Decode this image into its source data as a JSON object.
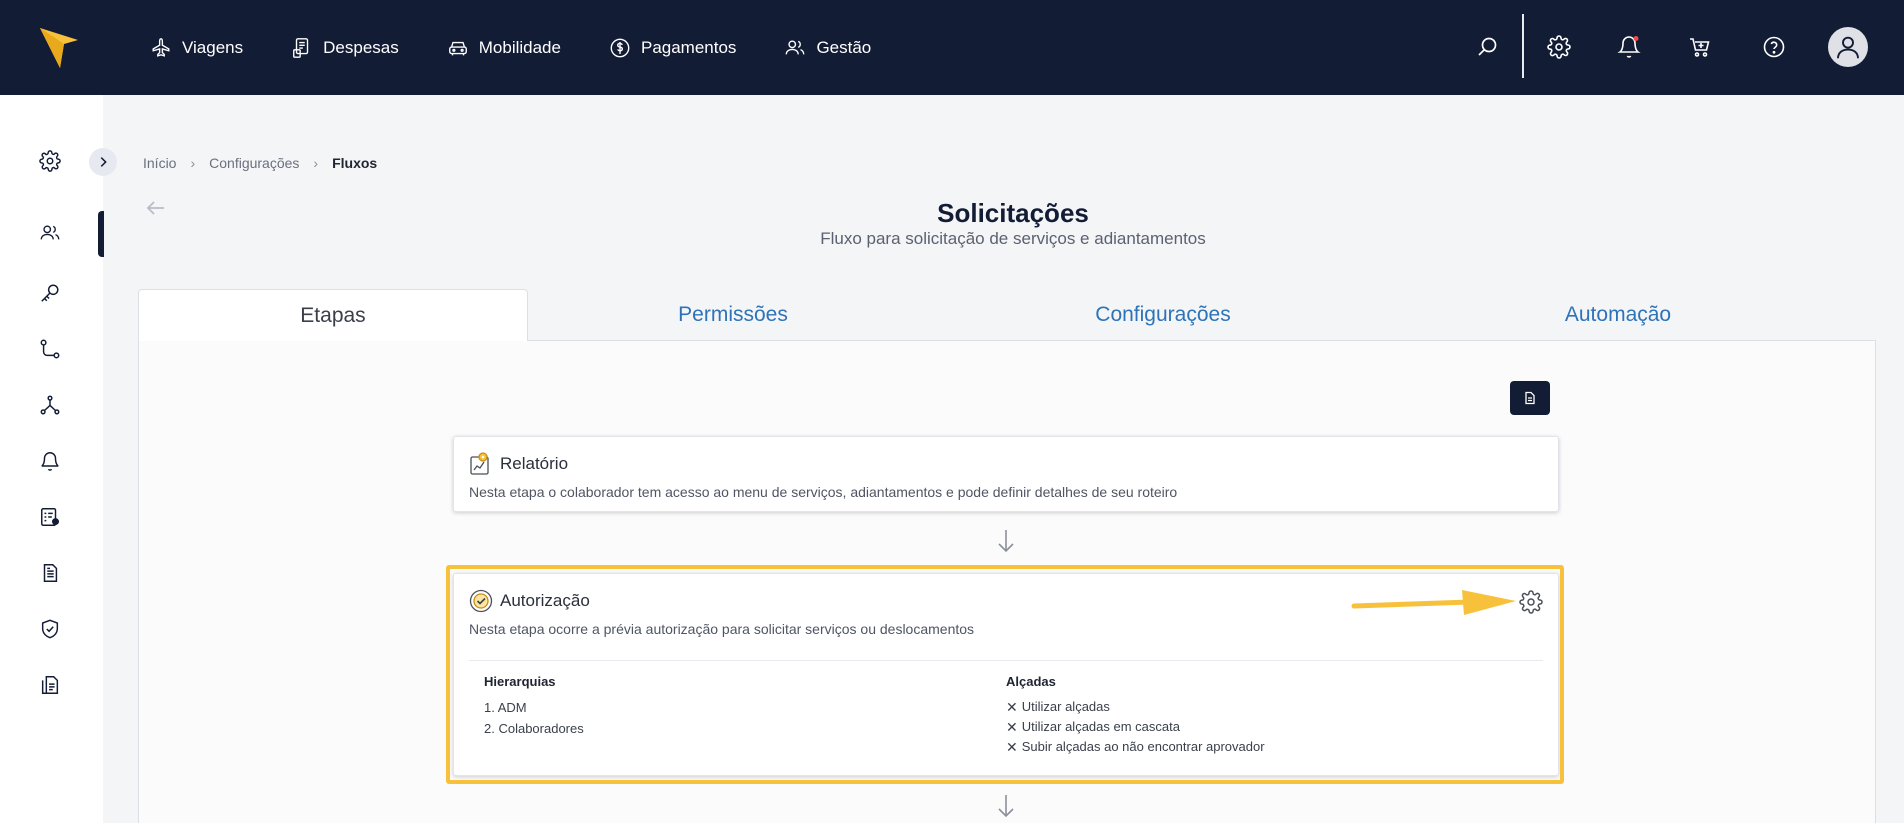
{
  "nav": {
    "items": [
      {
        "label": "Viagens",
        "icon": "plane-icon"
      },
      {
        "label": "Despesas",
        "icon": "receipt-icon"
      },
      {
        "label": "Mobilidade",
        "icon": "car-icon"
      },
      {
        "label": "Pagamentos",
        "icon": "dollar-icon"
      },
      {
        "label": "Gestão",
        "icon": "users-icon"
      }
    ]
  },
  "breadcrumb": {
    "items": [
      "Início",
      "Configurações",
      "Fluxos"
    ]
  },
  "page": {
    "title": "Solicitações",
    "subtitle": "Fluxo para solicitação de serviços e adiantamentos"
  },
  "tabs": [
    {
      "label": "Etapas",
      "active": true
    },
    {
      "label": "Permissões",
      "active": false
    },
    {
      "label": "Configurações",
      "active": false
    },
    {
      "label": "Automação",
      "active": false
    }
  ],
  "steps": [
    {
      "title": "Relatório",
      "description": "Nesta etapa o colaborador tem acesso ao menu de serviços, adiantamentos e pode definir detalhes de seu roteiro"
    },
    {
      "title": "Autorização",
      "description": "Nesta etapa ocorre a prévia autorização para solicitar serviços ou deslocamentos",
      "hierarchies_heading": "Hierarquias",
      "hierarchies": [
        "1. ADM",
        "2. Colaboradores"
      ],
      "alcadas_heading": "Alçadas",
      "alcadas": [
        "Utilizar alçadas",
        "Utilizar alçadas em cascata",
        "Subir alçadas ao não encontrar aprovador"
      ]
    }
  ],
  "colors": {
    "topbar": "#131c35",
    "tab_link": "#2e73b8",
    "highlight": "#f7c13b",
    "logo": "#f7c13b",
    "notification_dot": "#ef4b4b"
  }
}
